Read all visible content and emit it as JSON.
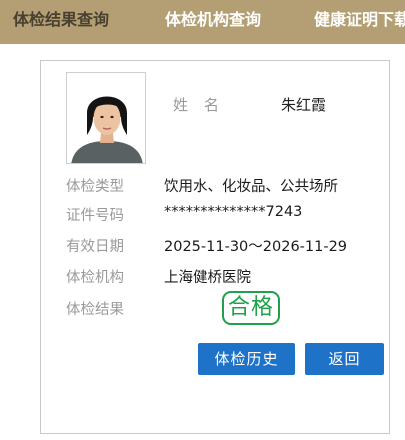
{
  "nav": {
    "tabs": [
      {
        "label": "体检结果查询"
      },
      {
        "label": "体检机构查询"
      },
      {
        "label": "健康证明下载"
      }
    ]
  },
  "card": {
    "name_label": "姓名",
    "name_value": "朱红霞",
    "rows": [
      {
        "label": "体检类型",
        "value": "饮用水、化妆品、公共场所"
      },
      {
        "label": "证件号码",
        "value": "**************7243"
      },
      {
        "label": "有效日期",
        "value": "2025-11-30～2026-11-29"
      },
      {
        "label": "体检机构",
        "value": "上海健桥医院"
      },
      {
        "label": "体检结果"
      }
    ],
    "result_stamp": "合格",
    "buttons": {
      "history": "体检历史",
      "back": "返回"
    }
  },
  "colors": {
    "topbar": "#b39f73",
    "active_tab_text": "#4a4030",
    "button": "#1e73c8",
    "stamp": "#1fa04a"
  },
  "icons": {
    "photo": "id-photo-portrait"
  }
}
